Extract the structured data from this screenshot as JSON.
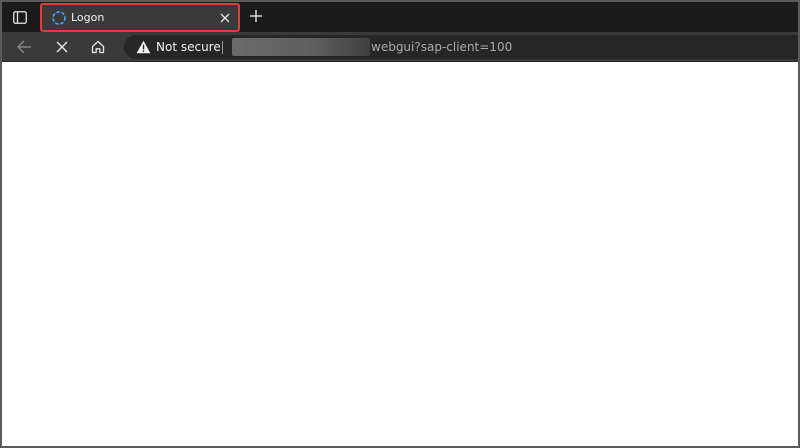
{
  "tab": {
    "title": "Logon"
  },
  "address_bar": {
    "security_label": "Not secure",
    "url_visible": "webgui?sap-client=100"
  },
  "icons": {
    "tab_actions": "tab-actions-icon",
    "loading": "loading-spinner-icon",
    "tab_close": "close-icon",
    "new_tab": "plus-icon",
    "back": "back-arrow-icon",
    "stop": "stop-icon",
    "home": "home-icon",
    "warning": "warning-icon"
  },
  "colors": {
    "tab_highlight_border": "#e03c3c",
    "spinner": "#4aa3ff",
    "tabstrip_bg": "#1b1b1b",
    "toolbar_bg": "#3a3a3a"
  }
}
